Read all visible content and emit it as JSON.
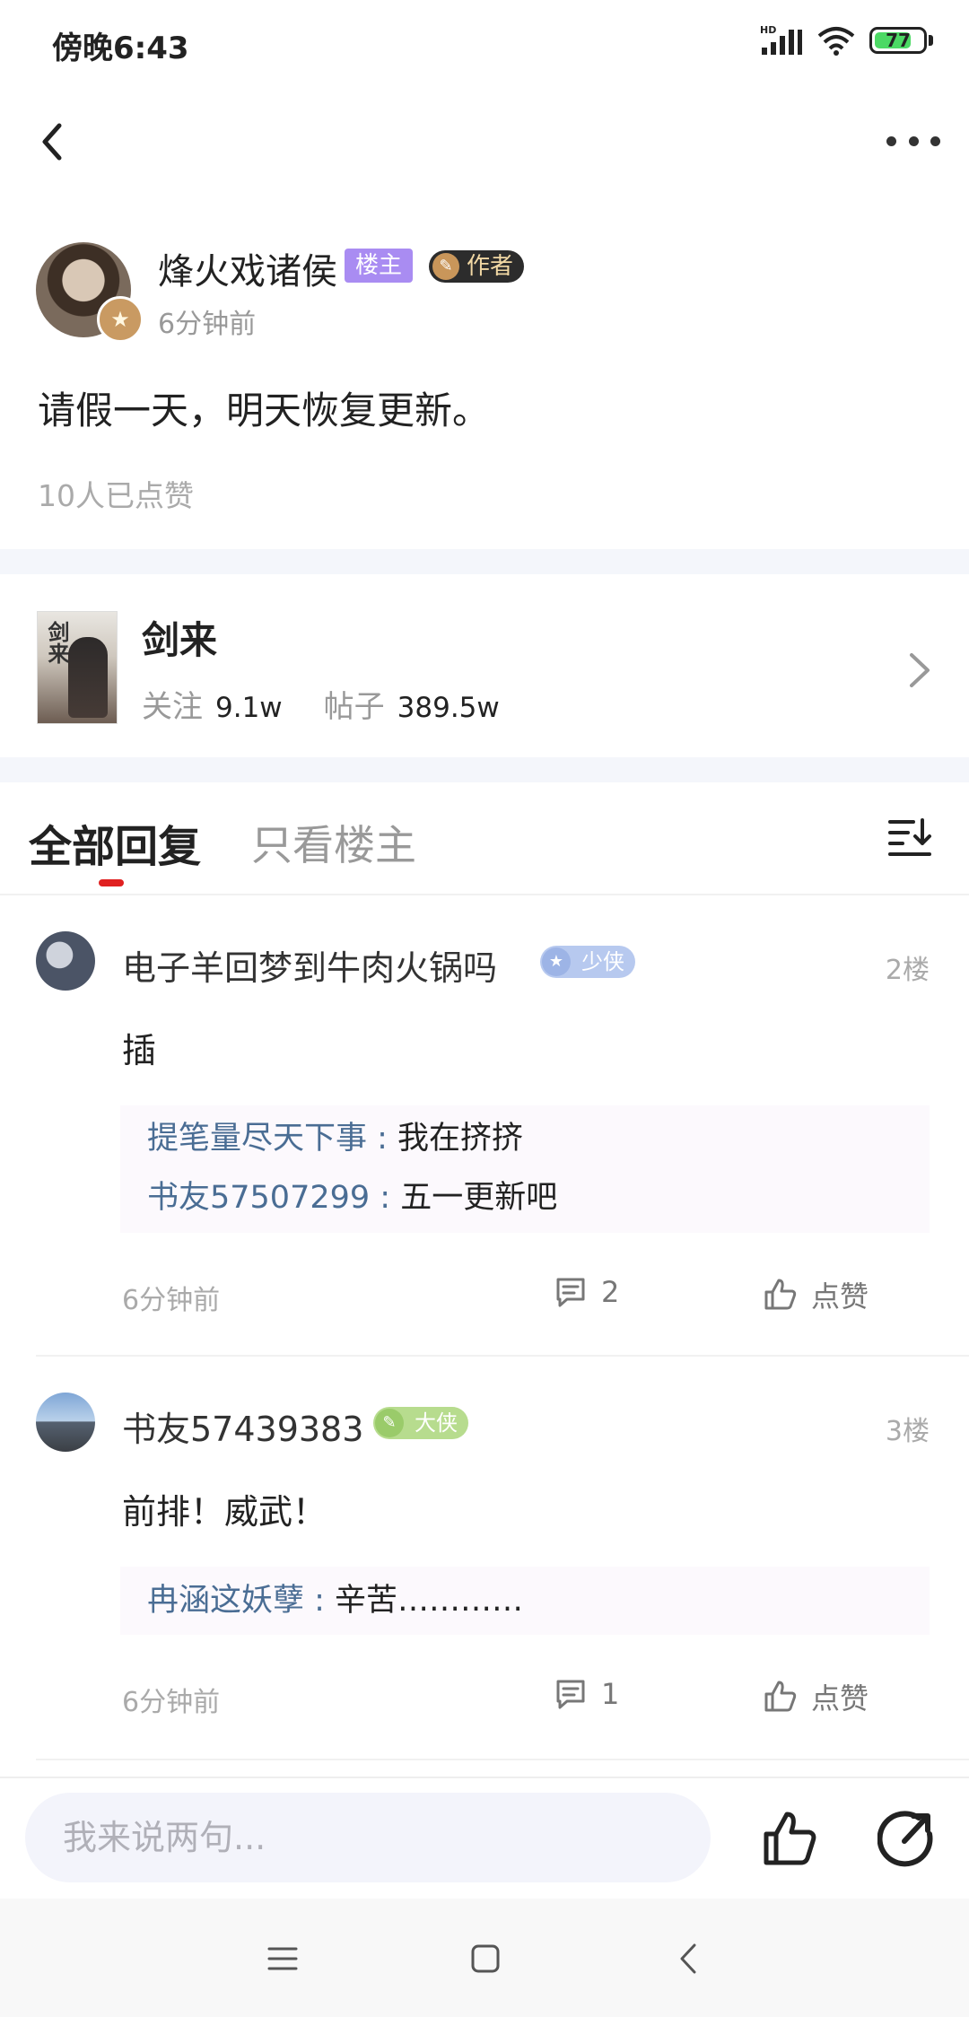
{
  "status_bar": {
    "time": "傍晚6:43",
    "network": "HD",
    "battery": "77",
    "battery_level": 0.77
  },
  "nav": {
    "back_icon": "chevron-left-icon",
    "more_icon": "more-dots-icon"
  },
  "post": {
    "author_name": "烽火戏诸侯",
    "owner_badge": "楼主",
    "author_tag": "作者",
    "time": "6分钟前",
    "content": "请假一天，明天恢复更新。",
    "likes": "10人已点赞"
  },
  "book": {
    "cover_text": "剑来",
    "title": "剑来",
    "follow_label": "关注",
    "follow_value": "9.1w",
    "posts_label": "帖子",
    "posts_value": "389.5w"
  },
  "tabs": {
    "all": "全部回复",
    "owner_only": "只看楼主"
  },
  "replies": [
    {
      "name": "电子羊回梦到牛肉火锅吗",
      "badge": "少侠",
      "badge_color": "#b7c9ef",
      "floor": "2楼",
      "text": "插",
      "subs": [
        {
          "user": "提笔量尽天下事 : ",
          "text": "我在挤挤"
        },
        {
          "user": "书友57507299 : ",
          "text": "五一更新吧"
        }
      ],
      "time": "6分钟前",
      "comments": "2",
      "like_label": "点赞"
    },
    {
      "name": "书友57439383",
      "badge": "大侠",
      "badge_color": "#b7dc8e",
      "floor": "3楼",
      "text": "前排！威武！",
      "subs": [
        {
          "user": "冉涵这妖孽 : ",
          "text": "辛苦…………"
        }
      ],
      "time": "6分钟前",
      "comments": "1",
      "like_label": "点赞"
    }
  ],
  "input": {
    "placeholder": "我来说两句..."
  },
  "bottom_icons": {
    "like": "thumbs-up-icon",
    "share": "share-icon"
  },
  "system_nav": {
    "menu": "menu-icon",
    "home": "home-icon",
    "back": "back-icon"
  }
}
